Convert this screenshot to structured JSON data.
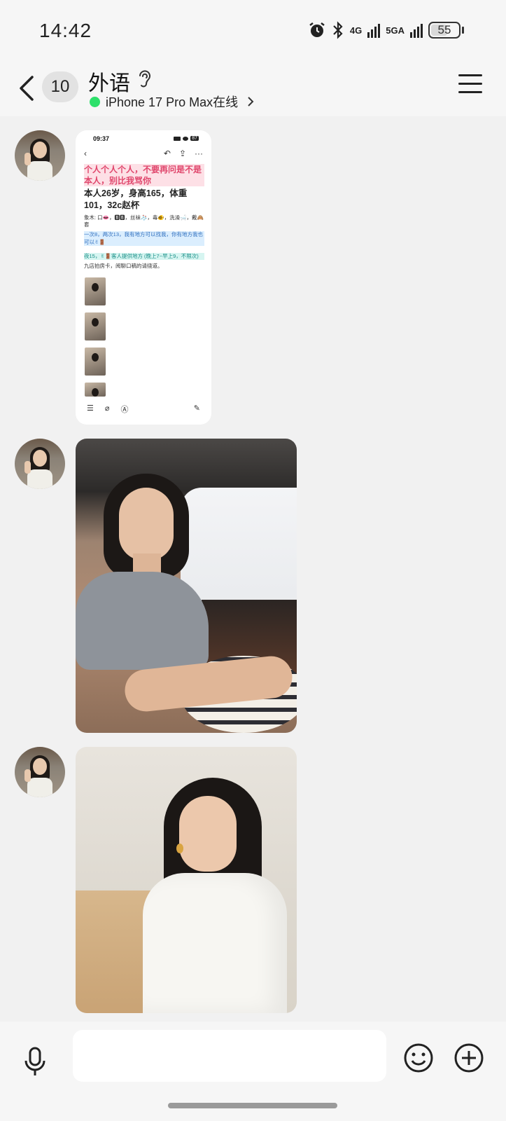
{
  "status_bar": {
    "time": "14:42",
    "network_1": "4G",
    "network_2": "5GA",
    "battery": "55",
    "icons": [
      "alarm-icon",
      "bluetooth-icon",
      "signal-icon",
      "battery-icon"
    ]
  },
  "header": {
    "unread_count": "10",
    "title": "外语",
    "online_status": "iPhone 17 Pro Max在线",
    "online_color": "#2ee06b"
  },
  "messages": [
    {
      "type": "image-screenshot",
      "screenshot": {
        "time": "09:37",
        "battery": "87",
        "line_1": "个人个人个人，不要再问是不是本人，别比我骂你",
        "line_2": "本人26岁，身高165，体重101，32c赵杯",
        "line_3": "象木: 口👄，🅱🅱，丝袜🧦，毒🐠，洗澡🛁，戴🙈套",
        "line_4": "一次8，两次13，我有地方可以找我，你有地方我也可以✌🚪",
        "line_5": "夜15，✌🚪客人提供地方 (晚上7~早上9，不限次)",
        "line_6": "九店拍房卡，阅聊口稿的请绕道。"
      }
    },
    {
      "type": "image-photo",
      "subject": "woman-in-car"
    },
    {
      "type": "image-photo",
      "subject": "woman-white-shirt"
    }
  ],
  "input_bar": {
    "placeholder": ""
  }
}
